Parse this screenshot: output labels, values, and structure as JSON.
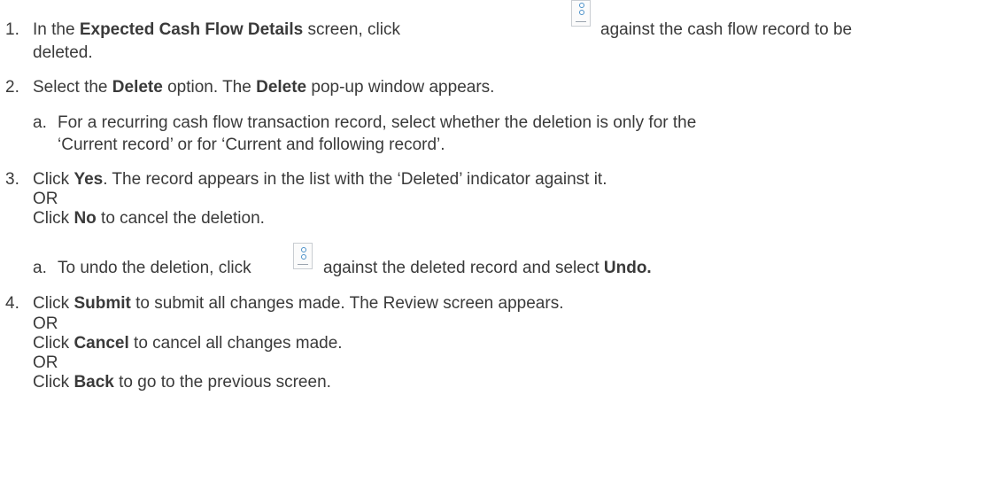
{
  "steps": [
    {
      "number": "1.",
      "pre": "In the ",
      "bold1": "Expected Cash Flow Details",
      "mid": " screen, click",
      "post": "against the cash flow record to be",
      "cont": "deleted."
    },
    {
      "number": "2.",
      "pre": "Select the ",
      "bold1": "Delete",
      "mid": " option. The ",
      "bold2": "Delete",
      "post": " pop-up window appears.",
      "sub": {
        "letter": "a.",
        "line1": "For a recurring cash flow transaction record, select whether the deletion is only for the",
        "line2": "‘Current record’ or for ‘Current and following record’."
      }
    },
    {
      "number": "3.",
      "pre": "Click ",
      "bold1": "Yes",
      "post": ". The record appears in the list with the ‘Deleted’ indicator against it.",
      "or": "OR",
      "alt_pre": "Click ",
      "alt_bold": "No",
      "alt_post": " to cancel the deletion.",
      "sub": {
        "letter": "a.",
        "pre": "To undo the deletion, click",
        "post": "against the deleted record and select ",
        "bold": "Undo."
      }
    },
    {
      "number": "4.",
      "pre": "Click ",
      "bold1": "Submit",
      "post": " to submit all changes made. The Review screen appears.",
      "or1": "OR",
      "alt1_pre": "Click ",
      "alt1_bold": "Cancel",
      "alt1_post": " to cancel all changes made.",
      "or2": "OR",
      "alt2_pre": "Click ",
      "alt2_bold": "Back",
      "alt2_post": " to go to the previous screen."
    }
  ],
  "icons": [
    "kebab-menu-icon",
    "kebab-menu-icon"
  ]
}
